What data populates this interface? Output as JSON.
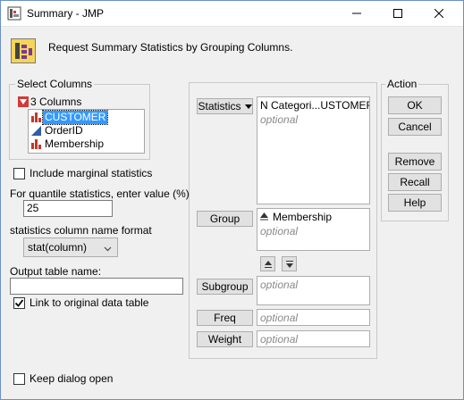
{
  "window": {
    "title": "Summary - JMP",
    "icon": "jmp-table-icon",
    "minimize_icon": "minimize-icon",
    "maximize_icon": "maximize-icon",
    "close_icon": "close-icon"
  },
  "header": {
    "icon": "summary-platform-icon",
    "text": "Request Summary Statistics by Grouping Columns."
  },
  "select_columns": {
    "label": "Select Columns",
    "count_label": "3 Columns",
    "columns": [
      {
        "name": "CUSTOMER",
        "type": "nominal",
        "selected": true
      },
      {
        "name": "OrderID",
        "type": "continuous",
        "selected": false
      },
      {
        "name": "Membership",
        "type": "nominal",
        "selected": false
      }
    ]
  },
  "options": {
    "include_marginal_label": "Include marginal statistics",
    "include_marginal_checked": false,
    "quantile_label": "For quantile statistics, enter value (%)",
    "quantile_value": "25",
    "format_label": "statistics column name format",
    "format_value": "stat(column)",
    "output_label": "Output table name:",
    "output_value": "",
    "link_label": "Link to original data table",
    "link_checked": true,
    "keep_open_label": "Keep dialog open",
    "keep_open_checked": false
  },
  "roles": {
    "statistics_label": "Statistics",
    "statistics_value": "N Categori...USTOMER)",
    "statistics_placeholder": "optional",
    "group_label": "Group",
    "group_value": "Membership",
    "group_placeholder": "optional",
    "subgroup_label": "Subgroup",
    "subgroup_placeholder": "optional",
    "freq_label": "Freq",
    "freq_placeholder": "optional",
    "weight_label": "Weight",
    "weight_placeholder": "optional"
  },
  "action": {
    "label": "Action",
    "ok": "OK",
    "cancel": "Cancel",
    "remove": "Remove",
    "recall": "Recall",
    "help": "Help"
  },
  "colors": {
    "nominal": "#c0392b",
    "continuous": "#2e5fa8",
    "selection": "#3399ff"
  }
}
